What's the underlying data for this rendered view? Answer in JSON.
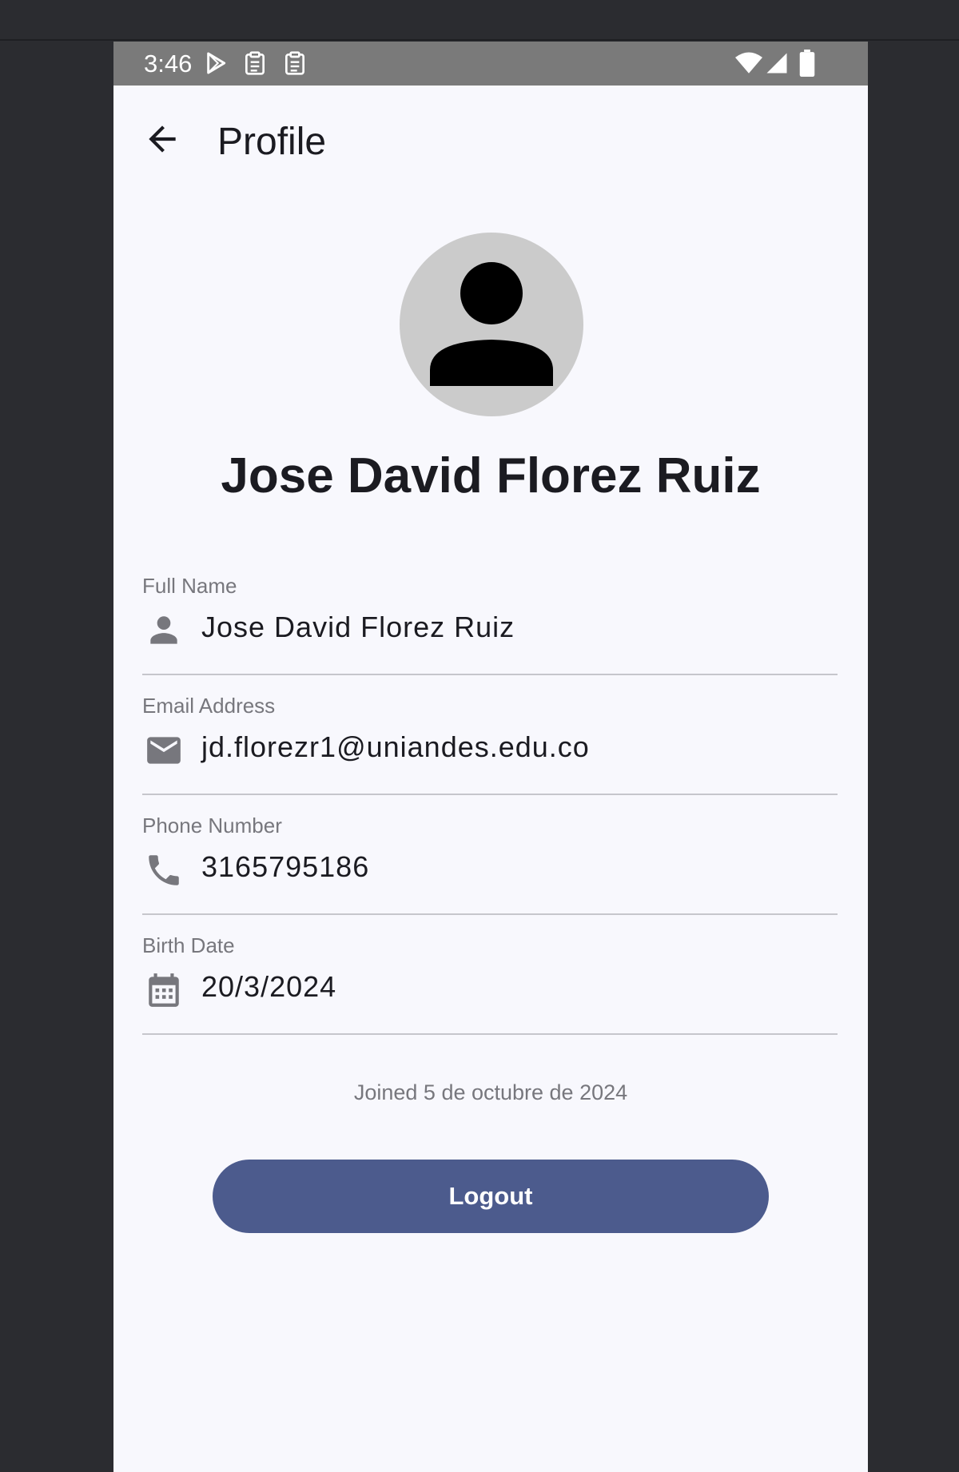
{
  "status_bar": {
    "time": "3:46",
    "icons": [
      "play-store-icon",
      "clipboard-icon",
      "clipboard-icon",
      "wifi-icon",
      "signal-icon",
      "battery-icon"
    ]
  },
  "header": {
    "title": "Profile",
    "back_icon": "arrow-back-icon"
  },
  "profile": {
    "avatar_icon": "person-icon",
    "display_name": "Jose David Florez Ruiz"
  },
  "fields": [
    {
      "label": "Full Name",
      "value": "Jose David Florez Ruiz",
      "icon": "person-icon"
    },
    {
      "label": "Email Address",
      "value": "jd.florezr1@uniandes.edu.co",
      "icon": "mail-icon"
    },
    {
      "label": "Phone Number",
      "value": "3165795186",
      "icon": "phone-icon"
    },
    {
      "label": "Birth Date",
      "value": "20/3/2024",
      "icon": "calendar-icon"
    }
  ],
  "joined_text": "Joined 5 de octubre de 2024",
  "logout_label": "Logout",
  "colors": {
    "background": "#f8f8fd",
    "status_bar": "#7a7a7a",
    "accent": "#4c5b8d",
    "avatar_bg": "#cbcbcb",
    "icon_gray": "#77777d"
  }
}
